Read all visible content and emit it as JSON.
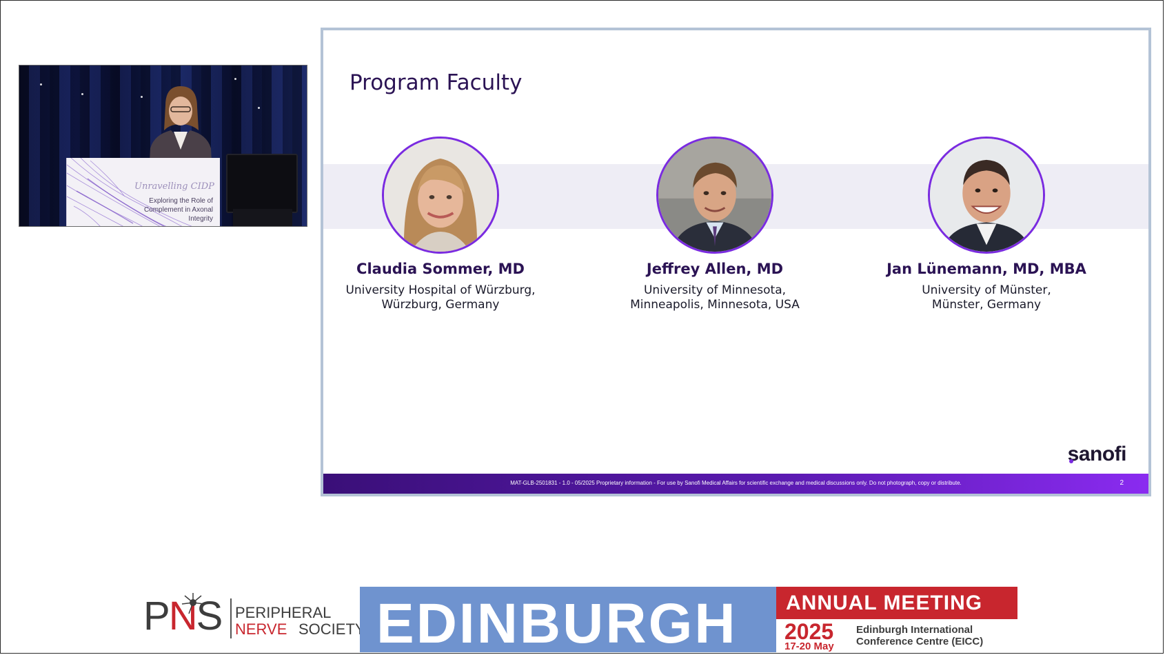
{
  "video": {
    "podium_script": "Unravelling CIDP",
    "podium_text": "Exploring the Role of Complement in Axonal Integrity"
  },
  "slide": {
    "title": "Program Faculty",
    "faculty": [
      {
        "name": "Claudia Sommer, MD",
        "affiliation": "University Hospital of Würzburg,\nWürzburg, Germany"
      },
      {
        "name": "Jeffrey Allen, MD",
        "affiliation": "University of Minnesota,\nMinneapolis, Minnesota, USA"
      },
      {
        "name": "Jan Lünemann, MD, MBA",
        "affiliation": "University of Münster,\nMünster, Germany"
      }
    ],
    "brand": "sanofi",
    "footer_text": "MAT-GLB-2501831 - 1.0 - 05/2025 Proprietary information - For use by Sanofi Medical Affairs for scientific exchange and medical discussions only. Do not photograph, copy or distribute.",
    "page_number": "2"
  },
  "banner": {
    "pns_letters_p": "P",
    "pns_letters_n": "N",
    "pns_letters_s": "S",
    "pns_line1": "PERIPHERAL",
    "pns_line2a": "NERVE",
    "pns_line2b": "SOCIETY",
    "city": "EDINBURGH",
    "event": "ANNUAL MEETING",
    "year": "2025",
    "dates": "17-20 May",
    "venue": "Edinburgh International\nConference Centre (EICC)"
  },
  "colors": {
    "slide_navy": "#2b1354",
    "avatar_ring": "#7a2be0",
    "footer_start": "#3a0f78",
    "footer_end": "#8a2bf0",
    "banner_blue": "#6f93cf",
    "banner_red": "#c8262e"
  }
}
